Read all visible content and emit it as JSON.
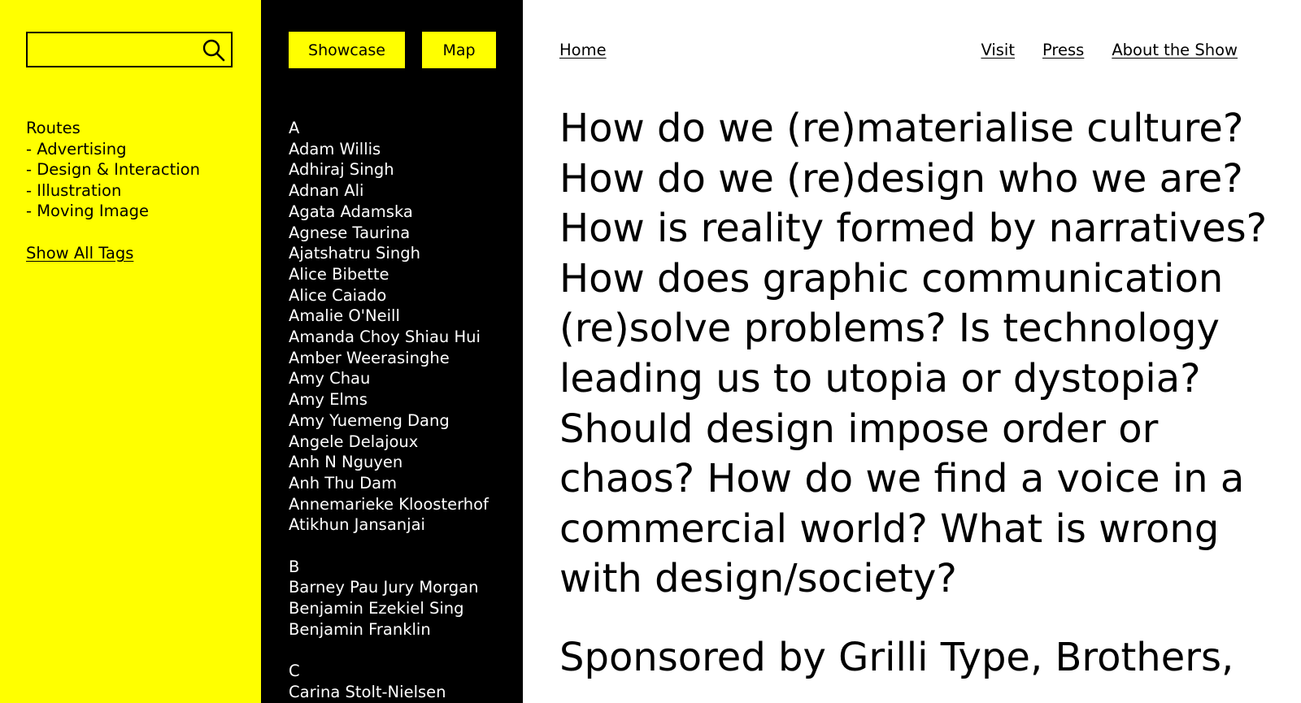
{
  "search": {
    "value": "",
    "placeholder": "",
    "icon": "search-icon"
  },
  "routes": {
    "title": "Routes",
    "items": [
      "- Advertising",
      "- Design & Interaction",
      "- Illustration",
      "- Moving Image"
    ]
  },
  "show_all_tags": "Show All Tags",
  "buttons": {
    "showcase": "Showcase",
    "map": "Map"
  },
  "artists": {
    "groups": [
      {
        "letter": "A",
        "names": [
          "Adam Willis",
          "Adhiraj Singh",
          "Adnan Ali",
          "Agata Adamska",
          "Agnese Taurina",
          "Ajatshatru Singh",
          "Alice Bibette",
          "Alice Caiado",
          "Amalie O'Neill",
          "Amanda Choy Shiau Hui",
          "Amber Weerasinghe",
          "Amy Chau",
          "Amy Elms",
          "Amy Yuemeng Dang",
          "Angele Delajoux",
          "Anh N Nguyen",
          "Anh Thu Dam",
          "Annemarieke Kloosterhof",
          "Atikhun Jansanjai"
        ]
      },
      {
        "letter": "B",
        "names": [
          "Barney Pau Jury Morgan",
          "Benjamin Ezekiel Sing",
          "Benjamin Franklin"
        ]
      },
      {
        "letter": "C",
        "names": [
          "Carina Stolt-Nielsen"
        ]
      }
    ]
  },
  "nav": {
    "home": "Home",
    "visit": "Visit",
    "press": "Press",
    "about": "About the Show"
  },
  "intro_text": "How do we (re)materialise culture? How do we (re)design who we are? How is reality formed by narratives? How does graphic communication (re)solve problems? Is technology leading us to utopia or dystopia? Should design impose order or chaos? How do we find a voice in a commercial world? What is wrong with design/society?",
  "sponsor_text": "Sponsored by Grilli Type, Brothers,",
  "colors": {
    "accent": "#ffff00",
    "dark": "#000000",
    "light": "#ffffff"
  }
}
